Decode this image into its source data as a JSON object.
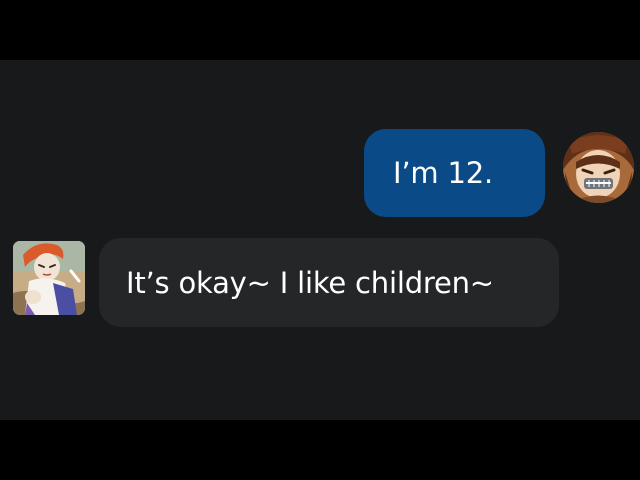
{
  "conversation": {
    "messages": [
      {
        "direction": "outgoing",
        "text": "I’m 12.",
        "avatar_icon": "anime-girl-avatar-icon",
        "bubble_color": "#0a4a86"
      },
      {
        "direction": "incoming",
        "text": "It’s okay~ I like children~",
        "avatar_icon": "anime-clown-avatar-icon",
        "bubble_color": "#252628"
      }
    ]
  },
  "colors": {
    "page_background": "#000000",
    "chat_background": "#18191b",
    "text": "#ffffff"
  }
}
